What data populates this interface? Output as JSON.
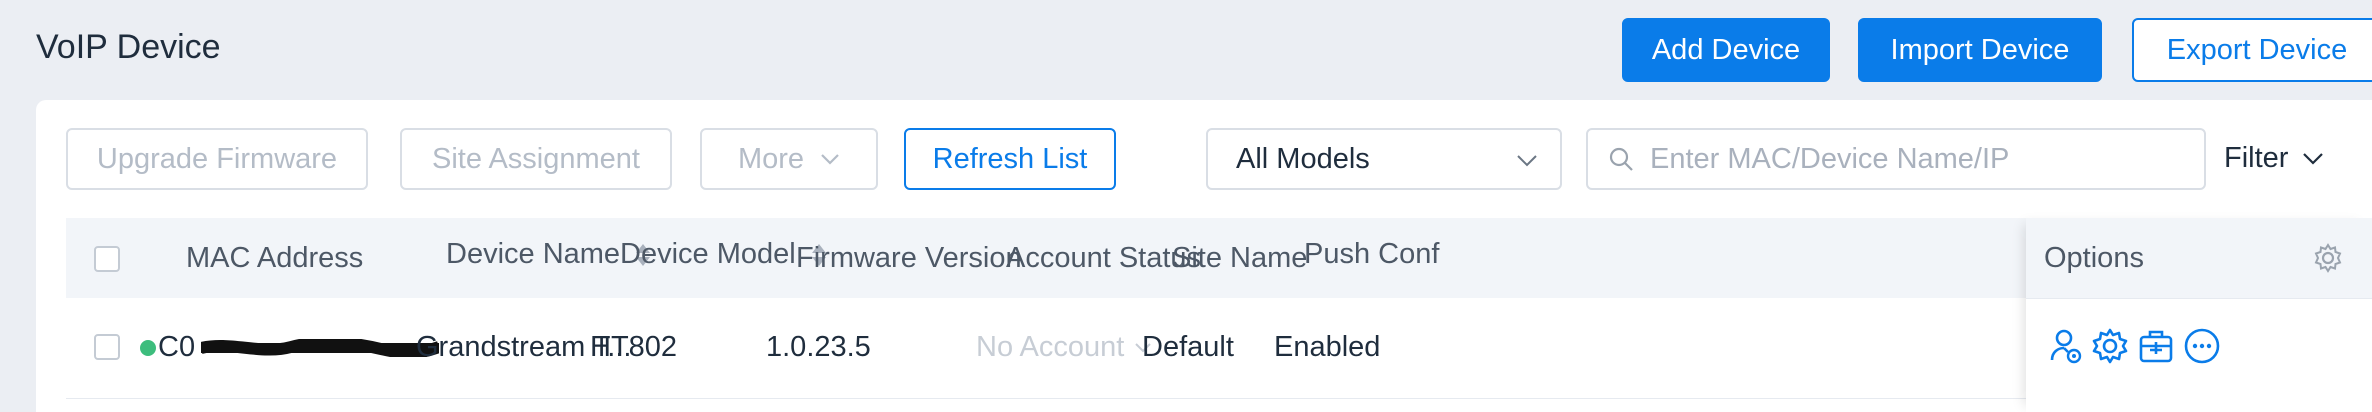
{
  "header": {
    "title": "VoIP Device",
    "add_device": "Add Device",
    "import_device": "Import Device",
    "export_device": "Export Device"
  },
  "toolbar": {
    "upgrade_firmware": "Upgrade Firmware",
    "site_assignment": "Site Assignment",
    "more": "More",
    "refresh_list": "Refresh List",
    "model_select": "All Models",
    "search_placeholder": "Enter MAC/Device Name/IP",
    "filter": "Filter"
  },
  "table": {
    "columns": {
      "mac": "MAC Address",
      "device_name": "Device Name",
      "device_model": "Device Model",
      "firmware": "Firmware Version",
      "account_status": "Account Status",
      "site_name": "Site Name",
      "push_config": "Push Conf",
      "options": "Options"
    },
    "rows": [
      {
        "mac": "C0",
        "device_name": "Grandstream T...",
        "device_model": "HT802",
        "firmware": "1.0.23.5",
        "account_status": "No Account",
        "site_name": "Default",
        "push_config": "Enabled",
        "status_color": "#3dbd7d"
      }
    ]
  },
  "colors": {
    "accent": "#0a7ce9",
    "online": "#3dbd7d"
  },
  "icons": [
    "search-icon",
    "chevron-down-icon",
    "sort-icon",
    "gear-icon",
    "user-settings-icon",
    "config-icon",
    "device-box-icon",
    "more-icon"
  ]
}
